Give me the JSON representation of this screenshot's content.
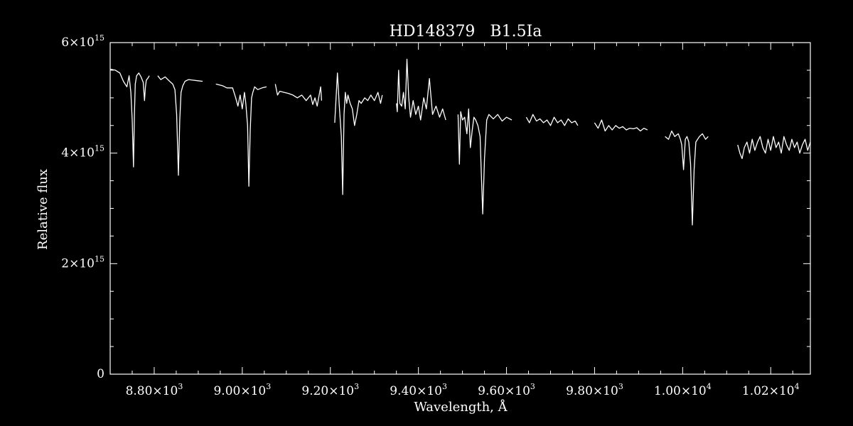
{
  "chart_data": {
    "type": "line",
    "title": "HD148379   B1.5Ia",
    "xlabel": "Wavelength, Å",
    "ylabel": "Relative flux",
    "xlim": [
      8700,
      10290
    ],
    "ylim": [
      0,
      6000000000000000.0
    ],
    "background": "#000000",
    "foreground": "#ffffff",
    "x_ticks": [
      {
        "value": 8800,
        "mantissa": "8.80",
        "exp": "3"
      },
      {
        "value": 9000,
        "mantissa": "9.00",
        "exp": "3"
      },
      {
        "value": 9200,
        "mantissa": "9.20",
        "exp": "3"
      },
      {
        "value": 9400,
        "mantissa": "9.40",
        "exp": "3"
      },
      {
        "value": 9600,
        "mantissa": "9.60",
        "exp": "3"
      },
      {
        "value": 9800,
        "mantissa": "9.80",
        "exp": "3"
      },
      {
        "value": 10000,
        "mantissa": "1.00",
        "exp": "4"
      },
      {
        "value": 10200,
        "mantissa": "1.02",
        "exp": "4"
      }
    ],
    "y_ticks": [
      {
        "value": 0,
        "mantissa": "0",
        "exp": ""
      },
      {
        "value": 2000000000000000.0,
        "mantissa": "2",
        "exp": "15"
      },
      {
        "value": 4000000000000000.0,
        "mantissa": "4",
        "exp": "15"
      },
      {
        "value": 6000000000000000.0,
        "mantissa": "6",
        "exp": "15"
      }
    ],
    "y_minor_step": 500000000000000.0,
    "times_symbol": "×10",
    "segments": [
      {
        "x": [
          8700,
          8712,
          8722,
          8730,
          8738,
          8743,
          8747,
          8750,
          8753,
          8755,
          8757,
          8760,
          8765,
          8770,
          8775,
          8778,
          8780,
          8782,
          8785,
          8789
        ],
        "y": [
          5520000000000000.0,
          5500000000000000.0,
          5450000000000000.0,
          5300000000000000.0,
          5200000000000000.0,
          5400000000000000.0,
          5100000000000000.0,
          4600000000000000.0,
          3750000000000000.0,
          4700000000000000.0,
          5250000000000000.0,
          5400000000000000.0,
          5450000000000000.0,
          5380000000000000.0,
          5280000000000000.0,
          4950000000000000.0,
          5200000000000000.0,
          5320000000000000.0,
          5350000000000000.0,
          5400000000000000.0
        ]
      },
      {
        "x": [
          8808,
          8815,
          8825,
          8835,
          8842,
          8847,
          8851,
          8855,
          8858,
          8861,
          8865,
          8870,
          8878,
          8888,
          8898,
          8910
        ],
        "y": [
          5400000000000000.0,
          5330000000000000.0,
          5380000000000000.0,
          5300000000000000.0,
          5250000000000000.0,
          5150000000000000.0,
          4700000000000000.0,
          3600000000000000.0,
          4600000000000000.0,
          5100000000000000.0,
          5220000000000000.0,
          5300000000000000.0,
          5330000000000000.0,
          5320000000000000.0,
          5310000000000000.0,
          5300000000000000.0
        ]
      },
      {
        "x": [
          8940,
          8955,
          8965,
          8978,
          8985,
          8990,
          8995,
          9000,
          9005,
          9008,
          9012,
          9015,
          9018,
          9021,
          9024,
          9028,
          9035,
          9045,
          9055
        ],
        "y": [
          5250000000000000.0,
          5220000000000000.0,
          5180000000000000.0,
          5180000000000000.0,
          5000000000000000.0,
          4850000000000000.0,
          5050000000000000.0,
          4800000000000000.0,
          5100000000000000.0,
          4900000000000000.0,
          4500000000000000.0,
          3400000000000000.0,
          4400000000000000.0,
          5000000000000000.0,
          5100000000000000.0,
          5200000000000000.0,
          5150000000000000.0,
          5180000000000000.0,
          5200000000000000.0
        ]
      },
      {
        "x": [
          9075,
          9080,
          9085,
          9095,
          9105,
          9115,
          9125,
          9135,
          9145,
          9155,
          9160,
          9165,
          9170,
          9178,
          9180
        ],
        "y": [
          5250000000000000.0,
          5050000000000000.0,
          5120000000000000.0,
          5100000000000000.0,
          5080000000000000.0,
          5050000000000000.0,
          5000000000000000.0,
          5050000000000000.0,
          4950000000000000.0,
          5050000000000000.0,
          4880000000000000.0,
          5000000000000000.0,
          4850000000000000.0,
          5200000000000000.0,
          4950000000000000.0
        ]
      },
      {
        "x": [
          9210,
          9213,
          9216,
          9220,
          9225,
          9228,
          9231,
          9234,
          9237,
          9240,
          9245,
          9250,
          9255,
          9260,
          9265,
          9270,
          9278,
          9285,
          9292,
          9300,
          9308,
          9314,
          9318
        ],
        "y": [
          4550000000000000.0,
          5000000000000000.0,
          5450000000000000.0,
          4900000000000000.0,
          4300000000000000.0,
          3250000000000000.0,
          4700000000000000.0,
          5100000000000000.0,
          4900000000000000.0,
          5050000000000000.0,
          4900000000000000.0,
          4800000000000000.0,
          4500000000000000.0,
          4700000000000000.0,
          4950000000000000.0,
          4900000000000000.0,
          5000000000000000.0,
          4950000000000000.0,
          5050000000000000.0,
          4950000000000000.0,
          5100000000000000.0,
          4900000000000000.0,
          5050000000000000.0
        ]
      },
      {
        "x": [
          9350,
          9352,
          9355,
          9358,
          9362,
          9366,
          9370,
          9374,
          9378,
          9382,
          9388,
          9394,
          9400,
          9405,
          9412,
          9418,
          9425,
          9432,
          9440,
          9448,
          9455,
          9462
        ],
        "y": [
          4900000000000000.0,
          4750000000000000.0,
          5500000000000000.0,
          4900000000000000.0,
          4850000000000000.0,
          5100000000000000.0,
          4800000000000000.0,
          5700000000000000.0,
          5000000000000000.0,
          4650000000000000.0,
          4950000000000000.0,
          4700000000000000.0,
          4850000000000000.0,
          4600000000000000.0,
          5000000000000000.0,
          4800000000000000.0,
          5350000000000000.0,
          4700000000000000.0,
          4850000000000000.0,
          4650000000000000.0,
          4800000000000000.0,
          4600000000000000.0
        ]
      },
      {
        "x": [
          9490,
          9493,
          9496,
          9500,
          9505,
          9510,
          9514,
          9518,
          9522,
          9526,
          9530,
          9535,
          9540,
          9543,
          9546,
          9550,
          9555,
          9560,
          9570,
          9580,
          9590,
          9600,
          9612
        ],
        "y": [
          4700000000000000.0,
          3800000000000000.0,
          4750000000000000.0,
          4600000000000000.0,
          4650000000000000.0,
          4350000000000000.0,
          4800000000000000.0,
          4100000000000000.0,
          4400000000000000.0,
          4650000000000000.0,
          4600000000000000.0,
          4500000000000000.0,
          4300000000000000.0,
          3600000000000000.0,
          2900000000000000.0,
          3900000000000000.0,
          4600000000000000.0,
          4700000000000000.0,
          4620000000000000.0,
          4700000000000000.0,
          4580000000000000.0,
          4650000000000000.0,
          4600000000000000.0
        ]
      },
      {
        "x": [
          9645,
          9652,
          9660,
          9668,
          9676,
          9684,
          9692,
          9700,
          9708,
          9716,
          9724,
          9732,
          9740,
          9748,
          9756,
          9762
        ],
        "y": [
          4650000000000000.0,
          4550000000000000.0,
          4700000000000000.0,
          4580000000000000.0,
          4620000000000000.0,
          4550000000000000.0,
          4600000000000000.0,
          4500000000000000.0,
          4650000000000000.0,
          4550000000000000.0,
          4600000000000000.0,
          4500000000000000.0,
          4620000000000000.0,
          4550000000000000.0,
          4580000000000000.0,
          4500000000000000.0
        ]
      },
      {
        "x": [
          9800,
          9808,
          9816,
          9824,
          9832,
          9840,
          9848,
          9856,
          9864,
          9872,
          9880,
          9888,
          9896,
          9904,
          9912,
          9920
        ],
        "y": [
          4550000000000000.0,
          4450000000000000.0,
          4600000000000000.0,
          4400000000000000.0,
          4500000000000000.0,
          4420000000000000.0,
          4500000000000000.0,
          4450000000000000.0,
          4480000000000000.0,
          4420000000000000.0,
          4450000000000000.0,
          4440000000000000.0,
          4460000000000000.0,
          4400000000000000.0,
          4450000000000000.0,
          4420000000000000.0
        ]
      },
      {
        "x": [
          9960,
          9968,
          9975,
          9982,
          9990,
          9995,
          9998,
          10002,
          10006,
          10010,
          10014,
          10018,
          10022,
          10026,
          10030,
          10038,
          10045,
          10052,
          10058
        ],
        "y": [
          4300000000000000.0,
          4250000000000000.0,
          4400000000000000.0,
          4300000000000000.0,
          4350000000000000.0,
          4250000000000000.0,
          4150000000000000.0,
          3700000000000000.0,
          4250000000000000.0,
          4300000000000000.0,
          4200000000000000.0,
          3800000000000000.0,
          2700000000000000.0,
          3700000000000000.0,
          4200000000000000.0,
          4300000000000000.0,
          4350000000000000.0,
          4250000000000000.0,
          4300000000000000.0
        ]
      },
      {
        "x": [
          10125,
          10130,
          10135,
          10140,
          10146,
          10152,
          10158,
          10164,
          10170,
          10176,
          10182,
          10188,
          10194,
          10200,
          10206,
          10212,
          10218,
          10224,
          10230,
          10236,
          10242,
          10248,
          10254,
          10260,
          10266,
          10272,
          10278,
          10284,
          10290
        ],
        "y": [
          4150000000000000.0,
          4000000000000000.0,
          3900000000000000.0,
          4100000000000000.0,
          4200000000000000.0,
          4000000000000000.0,
          4250000000000000.0,
          4050000000000000.0,
          4200000000000000.0,
          4300000000000000.0,
          4100000000000000.0,
          4000000000000000.0,
          4250000000000000.0,
          4050000000000000.0,
          4300000000000000.0,
          4100000000000000.0,
          4200000000000000.0,
          4000000000000000.0,
          4300000000000000.0,
          4150000000000000.0,
          4050000000000000.0,
          4250000000000000.0,
          4100000000000000.0,
          4200000000000000.0,
          4000000000000000.0,
          4150000000000000.0,
          4250000000000000.0,
          4050000000000000.0,
          4200000000000000.0
        ]
      }
    ]
  }
}
